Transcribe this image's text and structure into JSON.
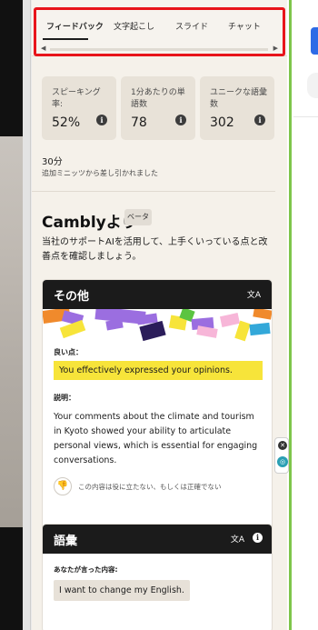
{
  "tabs": [
    {
      "label": "フィードバック",
      "active": true
    },
    {
      "label": "文字起こし",
      "active": false
    },
    {
      "label": "スライド",
      "active": false
    },
    {
      "label": "チャット",
      "active": false
    }
  ],
  "stats": [
    {
      "label": "スピーキング率:",
      "value": "52%"
    },
    {
      "label": "1分あたりの単語数",
      "value": "78"
    },
    {
      "label": "ユニークな語彙数",
      "value": "302"
    }
  ],
  "duration": {
    "value": "30分",
    "note": "追加ミニッツから差し引かれました"
  },
  "cambly": {
    "title": "Camblyより",
    "badge": "ベータ",
    "description": "当社のサポートAIを活用して、上手くいっている点と改善点を確認しましょう。"
  },
  "card_other": {
    "title": "その他",
    "good_label": "良い点：",
    "good_text": "You effectively expressed your opinions.",
    "explanation_label": "説明：",
    "explanation": "Your comments about the climate and tourism in Kyoto showed your ability to articulate personal views, which is essential for engaging conversations.",
    "feedback_text": "この内容は役に立たない、もしくは正確でない"
  },
  "card_vocab": {
    "title": "語彙",
    "said_label": "あなたが言った内容:",
    "said_text": "I want to change my English."
  },
  "colors": {
    "highlight": "#e8141b",
    "good_bg": "#f7e43a",
    "card_header": "#1b1b1b",
    "accent_green": "#7ec54b",
    "accent_blue": "#2e6be6"
  }
}
